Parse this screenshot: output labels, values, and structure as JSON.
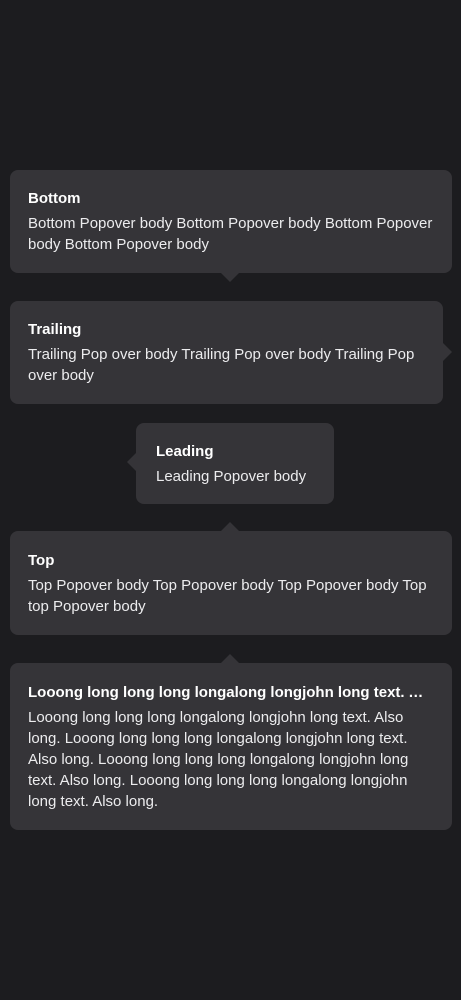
{
  "popovers": {
    "bottom": {
      "title": "Bottom",
      "body": "Bottom Popover body Bottom Popover body Bottom Popover body Bottom Popover body"
    },
    "trailing": {
      "title": "Trailing",
      "body": "Trailing Pop over body Trailing Pop over body Trailing Pop over body"
    },
    "leading": {
      "title": "Leading",
      "body": "Leading Popover body"
    },
    "top": {
      "title": "Top",
      "body": "Top Popover body Top Popover body Top Popover body Top top Popover body"
    },
    "long": {
      "title": "Looong long long long longalong longjohn long text. Also long.",
      "body": "Looong long long long longalong longjohn long text. Also long. Looong long long long longalong longjohn long text. Also long. Looong long long long longalong longjohn long text. Also long. Looong long long long longalong longjohn long text. Also long."
    }
  },
  "colors": {
    "background": "#1c1c1f",
    "popover": "#353438",
    "text": "#ffffff"
  }
}
